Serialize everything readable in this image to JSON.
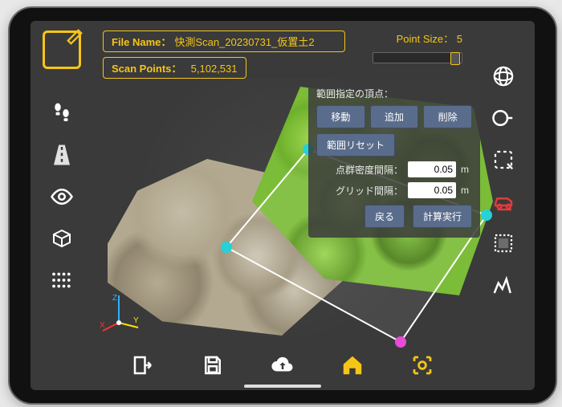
{
  "header": {
    "file_name_label": "File Name：",
    "file_name_value": "快測Scan_20230731_仮置土2",
    "scan_points_label": "Scan Points：",
    "scan_points_value": "5,102,531",
    "point_size_label": "Point Size：",
    "point_size_value": "5"
  },
  "panel": {
    "title": "範囲指定の頂点：",
    "btn_move": "移動",
    "btn_add": "追加",
    "btn_delete": "削除",
    "btn_reset": "範囲リセット",
    "density_label": "点群密度間隔：",
    "density_value": "0.05",
    "grid_label": "グリッド間隔：",
    "grid_value": "0.05",
    "unit": "m",
    "btn_back": "戻る",
    "btn_run": "計算実行"
  },
  "left_tools": [
    "edit",
    "footsteps",
    "road",
    "eye",
    "cube",
    "grid"
  ],
  "right_tools": [
    "orbit",
    "measure",
    "crop-lasso",
    "car-area",
    "crop-rect",
    "contour"
  ],
  "bottom_tools": [
    "export",
    "save",
    "upload",
    "home",
    "capture"
  ],
  "axes": {
    "x": "X",
    "y": "Y",
    "z": "Z"
  }
}
